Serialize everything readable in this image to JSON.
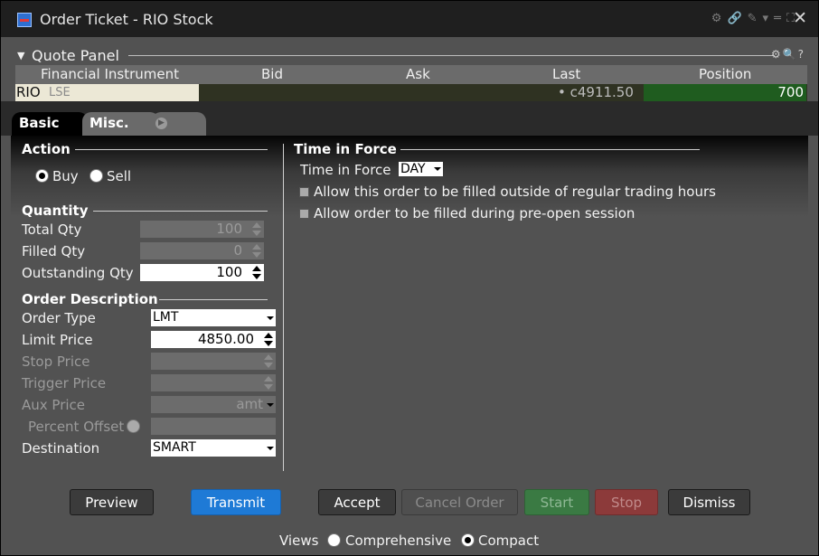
{
  "window": {
    "title": "Order Ticket - RIO Stock",
    "close_glyph": "✕",
    "icons": [
      "settings-icon",
      "link-icon",
      "pin-icon",
      "chevron-down-icon",
      "minimize-icon",
      "maximize-icon"
    ]
  },
  "quote_panel": {
    "title": "Quote Panel",
    "columns": [
      "Financial Instrument",
      "Bid",
      "Ask",
      "Last",
      "Position"
    ],
    "row": {
      "symbol": "RIO",
      "exchange": "LSE",
      "bid": "",
      "ask": "",
      "last": "• c4911.50",
      "position": "700"
    }
  },
  "tabs": [
    {
      "label": "Basic",
      "active": true
    },
    {
      "label": "Misc.",
      "active": false
    },
    {
      "label": "",
      "active": false
    }
  ],
  "action": {
    "title": "Action",
    "buy": "Buy",
    "sell": "Sell",
    "selected": "Buy"
  },
  "quantity": {
    "title": "Quantity",
    "total_label": "Total Qty",
    "total_value": "100",
    "filled_label": "Filled Qty",
    "filled_value": "0",
    "outstanding_label": "Outstanding Qty",
    "outstanding_value": "100"
  },
  "order_description": {
    "title": "Order Description",
    "order_type_label": "Order Type",
    "order_type_value": "LMT",
    "limit_price_label": "Limit Price",
    "limit_price_value": "4850.00",
    "stop_price_label": "Stop Price",
    "stop_price_value": "",
    "trigger_price_label": "Trigger Price",
    "trigger_price_value": "",
    "aux_price_label": "Aux Price",
    "aux_price_value": "amt",
    "percent_offset_label": "Percent Offset",
    "percent_offset_value": "",
    "destination_label": "Destination",
    "destination_value": "SMART"
  },
  "time_in_force": {
    "title": "Time in Force",
    "label": "Time in Force",
    "value": "DAY",
    "outside_rth": "Allow this order to be filled outside of regular trading hours",
    "pre_open": "Allow order to be filled during pre-open session"
  },
  "buttons": {
    "preview": "Preview",
    "transmit": "Transmit",
    "accept": "Accept",
    "cancel_order": "Cancel Order",
    "start": "Start",
    "stop": "Stop",
    "dismiss": "Dismiss"
  },
  "views": {
    "label": "Views",
    "comprehensive": "Comprehensive",
    "compact": "Compact",
    "selected": "Compact"
  }
}
